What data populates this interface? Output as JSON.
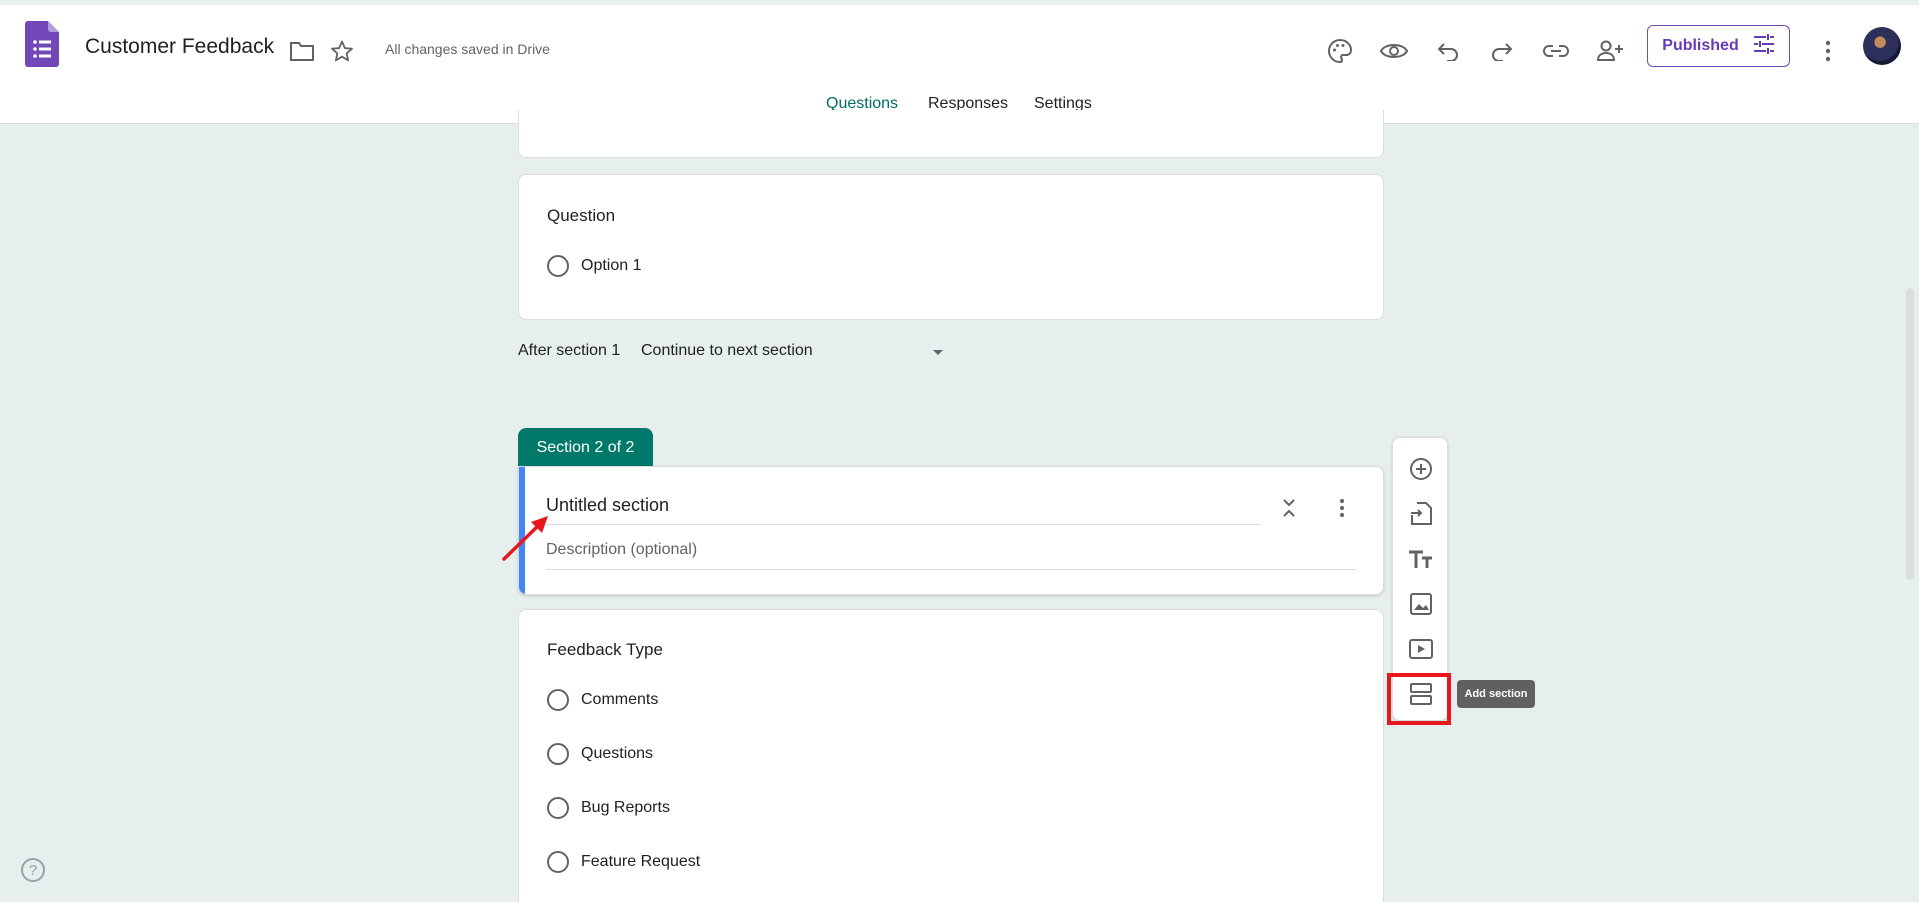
{
  "header": {
    "title": "Customer Feedback",
    "saved_status": "All changes saved in Drive",
    "published_label": "Published",
    "tabs": [
      {
        "label": "Questions",
        "active": true
      },
      {
        "label": "Responses",
        "active": false
      },
      {
        "label": "Settings",
        "active": false
      }
    ],
    "icons": [
      "forms-logo-icon",
      "folder-icon",
      "star-icon",
      "palette-icon",
      "preview-eye-icon",
      "undo-icon",
      "redo-icon",
      "link-icon",
      "add-collaborator-icon",
      "tune-icon",
      "more-vert-icon",
      "avatar"
    ]
  },
  "section1": {
    "question_title": "Question",
    "option": "Option 1",
    "after_label": "After section 1",
    "after_value": "Continue to next section"
  },
  "section2": {
    "tab_label": "Section 2 of 2",
    "title": "Untitled section",
    "description_placeholder": "Description (optional)"
  },
  "question2": {
    "title": "Feedback Type",
    "options": [
      "Comments",
      "Questions",
      "Bug Reports",
      "Feature Request"
    ]
  },
  "toolbar": {
    "tools": [
      "add-question-icon",
      "import-questions-icon",
      "add-title-icon",
      "add-image-icon",
      "add-video-icon",
      "add-section-icon"
    ],
    "tooltip": "Add section"
  },
  "colors": {
    "accent": "#00796b",
    "brand_purple": "#673ab7",
    "section_bar": "#4285f4",
    "highlight": "#e8171d",
    "background": "#e6efee"
  }
}
